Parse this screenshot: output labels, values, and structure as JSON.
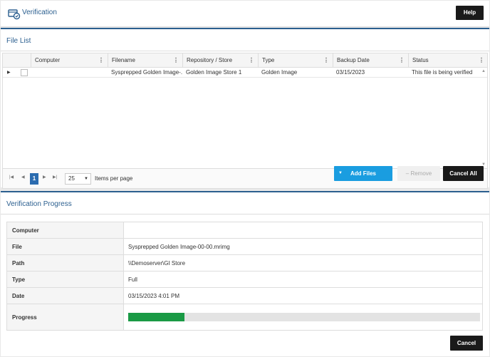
{
  "header": {
    "title": "Verification",
    "help_label": "Help"
  },
  "file_list": {
    "title": "File List",
    "columns": [
      "Computer",
      "Filename",
      "Repository / Store",
      "Type",
      "Backup Date",
      "Status"
    ],
    "rows": [
      {
        "computer": "",
        "filename": "Sysprepped Golden Image-...",
        "repository": "Golden Image Store 1",
        "type": "Golden Image",
        "backup_date": "03/15/2023",
        "status": "This file is being verified"
      }
    ],
    "pager": {
      "current_page": "1",
      "page_size": "25",
      "items_per_page_label": "Items per page"
    },
    "buttons": {
      "add_files": "Add Files",
      "remove": "– Remove",
      "cancel_all": "Cancel All"
    }
  },
  "progress": {
    "title": "Verification Progress",
    "fields": [
      {
        "label": "Computer",
        "value": ""
      },
      {
        "label": "File",
        "value": "Sysprepped Golden Image-00-00.mrimg"
      },
      {
        "label": "Path",
        "value": "\\\\Demoserver\\GI Store"
      },
      {
        "label": "Type",
        "value": "Full"
      },
      {
        "label": "Date",
        "value": "03/15/2023 4:01 PM"
      }
    ],
    "progress_label": "Progress",
    "progress_fraction": 0.16,
    "cancel_label": "Cancel"
  },
  "colors": {
    "accent": "#2b5f8f",
    "primary_button": "#1a9de0",
    "progress_fill": "#1a9a45",
    "dark_button": "#1a1a1a"
  }
}
